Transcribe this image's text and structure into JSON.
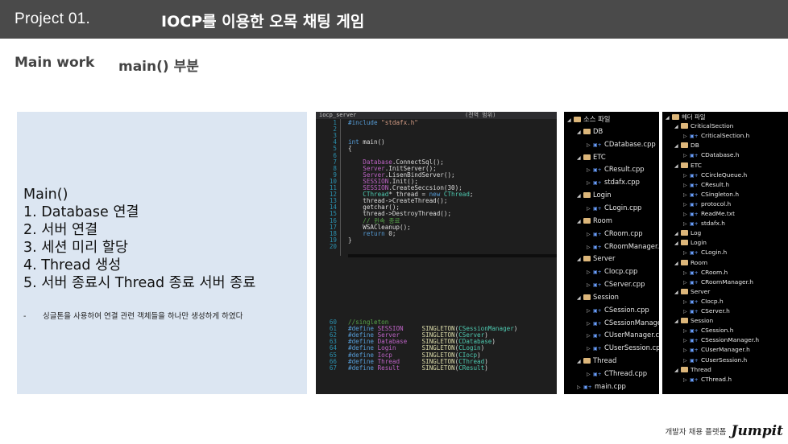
{
  "header": {
    "project": "Project 01.",
    "title": "IOCP를 이용한 오목 채팅 게임"
  },
  "subheader": {
    "label": "Main work",
    "value": "main() 부분"
  },
  "left_panel": {
    "heading": "Main()",
    "steps": [
      "1.  Database 연결",
      "2.  서버 연결",
      "3.  세션 미리 할당",
      "4.  Thread 생성",
      "5.  서버 종료시 Thread 종료 서버 종료"
    ],
    "note_dash": "-",
    "note": "싱글톤을 사용하여 연결 관련 객체들을 하나만 생성하게 하였다"
  },
  "code_tab": {
    "filename": "iocp_server",
    "scope": "(전역 범위)"
  },
  "code_lines": [
    {
      "n": "1",
      "t": "#include \"stdafx.h\""
    },
    {
      "n": "2",
      "t": ""
    },
    {
      "n": "3",
      "t": ""
    },
    {
      "n": "4",
      "t": "int main()"
    },
    {
      "n": "5",
      "t": "{"
    },
    {
      "n": "6",
      "t": ""
    },
    {
      "n": "7",
      "t": "    Database.ConnectSql();"
    },
    {
      "n": "8",
      "t": "    Server.InitServer();"
    },
    {
      "n": "9",
      "t": "    Server.LisenBindServer();"
    },
    {
      "n": "10",
      "t": "    SESSION.Init();"
    },
    {
      "n": "11",
      "t": "    SESSION.CreateSeccsion(30);"
    },
    {
      "n": "12",
      "t": "    CThread* thread = new CThread;"
    },
    {
      "n": "13",
      "t": "    thread->CreateThread();"
    },
    {
      "n": "14",
      "t": "    getchar();"
    },
    {
      "n": "15",
      "t": "    thread->DestroyThread();"
    },
    {
      "n": "16",
      "t": "    // 윈속 종료"
    },
    {
      "n": "17",
      "t": "    WSACleanup();"
    },
    {
      "n": "18",
      "t": "    return 0;"
    },
    {
      "n": "19",
      "t": "}"
    },
    {
      "n": "20",
      "t": ""
    }
  ],
  "define_lines": [
    {
      "n": "60",
      "t": "//singleton"
    },
    {
      "n": "61",
      "t": "#define SESSION     SINGLETON(CSessionManager)"
    },
    {
      "n": "62",
      "t": "#define Server      SINGLETON(CServer)"
    },
    {
      "n": "63",
      "t": "#define Database    SINGLETON(CDatabase)"
    },
    {
      "n": "64",
      "t": "#define Login       SINGLETON(CLogin)"
    },
    {
      "n": "65",
      "t": "#define Iocp        SINGLETON(CIocp)"
    },
    {
      "n": "66",
      "t": "#define Thread      SINGLETON(CThread)"
    },
    {
      "n": "67",
      "t": "#define Result      SINGLETON(CResult)"
    }
  ],
  "source_tree": [
    {
      "d": 0,
      "k": "folder",
      "t": "소스 파일"
    },
    {
      "d": 1,
      "k": "folder",
      "t": "DB"
    },
    {
      "d": 2,
      "k": "file",
      "t": "CDatabase.cpp"
    },
    {
      "d": 1,
      "k": "folder",
      "t": "ETC"
    },
    {
      "d": 2,
      "k": "file",
      "t": "CResult.cpp"
    },
    {
      "d": 2,
      "k": "file",
      "t": "stdafx.cpp"
    },
    {
      "d": 1,
      "k": "folder",
      "t": "Login"
    },
    {
      "d": 2,
      "k": "file",
      "t": "CLogin.cpp"
    },
    {
      "d": 1,
      "k": "folder",
      "t": "Room"
    },
    {
      "d": 2,
      "k": "file",
      "t": "CRoom.cpp"
    },
    {
      "d": 2,
      "k": "file",
      "t": "CRoomManager.cpp"
    },
    {
      "d": 1,
      "k": "folder",
      "t": "Server"
    },
    {
      "d": 2,
      "k": "file",
      "t": "CIocp.cpp"
    },
    {
      "d": 2,
      "k": "file",
      "t": "CServer.cpp"
    },
    {
      "d": 1,
      "k": "folder",
      "t": "Session"
    },
    {
      "d": 2,
      "k": "file",
      "t": "CSession.cpp"
    },
    {
      "d": 2,
      "k": "file",
      "t": "CSessionManager.cpp"
    },
    {
      "d": 2,
      "k": "file",
      "t": "CUserManager.cpp"
    },
    {
      "d": 2,
      "k": "file",
      "t": "CUserSession.cpp"
    },
    {
      "d": 1,
      "k": "folder",
      "t": "Thread"
    },
    {
      "d": 2,
      "k": "file",
      "t": "CThread.cpp"
    },
    {
      "d": 1,
      "k": "file",
      "t": "main.cpp"
    }
  ],
  "header_tree": [
    {
      "d": 0,
      "k": "folder",
      "t": "헤더 파일"
    },
    {
      "d": 1,
      "k": "folder",
      "t": "CriticalSection"
    },
    {
      "d": 2,
      "k": "file",
      "t": "CriticalSection.h"
    },
    {
      "d": 1,
      "k": "folder",
      "t": "DB"
    },
    {
      "d": 2,
      "k": "file",
      "t": "CDatabase.h"
    },
    {
      "d": 1,
      "k": "folder",
      "t": "ETC"
    },
    {
      "d": 2,
      "k": "file",
      "t": "CCircleQueue.h"
    },
    {
      "d": 2,
      "k": "file",
      "t": "CResult.h"
    },
    {
      "d": 2,
      "k": "file",
      "t": "CSingleton.h"
    },
    {
      "d": 2,
      "k": "file",
      "t": "protocol.h"
    },
    {
      "d": 2,
      "k": "file",
      "t": "ReadMe.txt"
    },
    {
      "d": 2,
      "k": "file",
      "t": "stdafx.h"
    },
    {
      "d": 1,
      "k": "folder",
      "t": "Log"
    },
    {
      "d": 1,
      "k": "folder",
      "t": "Login"
    },
    {
      "d": 2,
      "k": "file",
      "t": "CLogin.h"
    },
    {
      "d": 1,
      "k": "folder",
      "t": "Room"
    },
    {
      "d": 2,
      "k": "file",
      "t": "CRoom.h"
    },
    {
      "d": 2,
      "k": "file",
      "t": "CRoomManager.h"
    },
    {
      "d": 1,
      "k": "folder",
      "t": "Server"
    },
    {
      "d": 2,
      "k": "file",
      "t": "CIocp.h"
    },
    {
      "d": 2,
      "k": "file",
      "t": "CServer.h"
    },
    {
      "d": 1,
      "k": "folder",
      "t": "Session"
    },
    {
      "d": 2,
      "k": "file",
      "t": "CSession.h"
    },
    {
      "d": 2,
      "k": "file",
      "t": "CSessionManager.h"
    },
    {
      "d": 2,
      "k": "file",
      "t": "CUserManager.h"
    },
    {
      "d": 2,
      "k": "file",
      "t": "CUserSession.h"
    },
    {
      "d": 1,
      "k": "folder",
      "t": "Thread"
    },
    {
      "d": 2,
      "k": "file",
      "t": "CThread.h"
    }
  ],
  "footer": {
    "text": "개발자 채용 플랫폼",
    "brand": "Jumpit"
  }
}
